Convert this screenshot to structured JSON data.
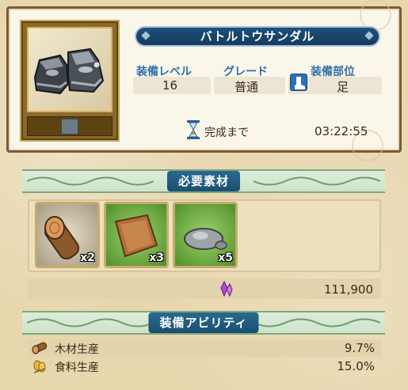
{
  "item": {
    "name": "バトルトウサンダル",
    "image_icon": "steel-sandals-icon",
    "equip_level_label": "装備レベル",
    "equip_level": "16",
    "grade_label": "グレード",
    "grade": "普通",
    "slot_label": "装備部位",
    "slot_icon": "foot-slot-icon",
    "slot": "足"
  },
  "crafting": {
    "complete_label": "完成まで",
    "remaining_time": "03:22:55"
  },
  "materials_section": {
    "title": "必要素材",
    "items": [
      {
        "icon": "log-icon",
        "qty": "x2"
      },
      {
        "icon": "leather-icon",
        "qty": "x3"
      },
      {
        "icon": "stone-icon",
        "qty": "x5"
      }
    ],
    "cost_icon": "crystal-icon",
    "cost": "111,900"
  },
  "abilities_section": {
    "title": "装備アビリティ",
    "abilities": [
      {
        "icon": "wood-icon",
        "label": "木材生産",
        "value": "9.7%"
      },
      {
        "icon": "grain-icon",
        "label": "食料生産",
        "value": "15.0%"
      }
    ]
  },
  "colors": {
    "banner_blue": "#1f4f7a",
    "label_blue": "#2f6fa6",
    "frame_brown": "#7a5a36",
    "section_green": "#cfe3cb"
  }
}
